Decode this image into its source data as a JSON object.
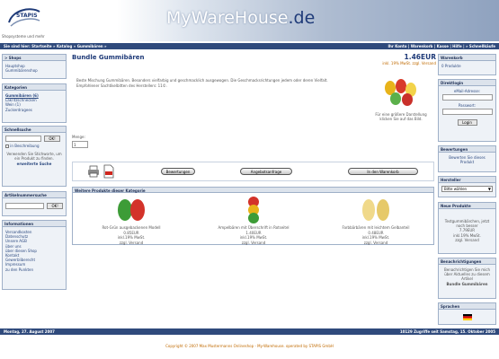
{
  "header": {
    "brand_main": "MyWareHouse",
    "brand_tld": ".de",
    "logo_text": "STAPIS",
    "slogan": "Shopsysteme und mehr"
  },
  "nav": {
    "breadcrumb": "Sie sind hier: Startseite » Katalog » Gummibären »",
    "toplinks": "Ihr Konto | Warenkorb | Kasse | Hilfe | » Schnellkäufe"
  },
  "left": {
    "shops": {
      "title": "> Shops",
      "items": [
        "Hauptshop",
        "Gummibärenshop"
      ]
    },
    "categories": {
      "title": "Kategorien",
      "items": [
        "Gummibären (6)",
        "Lakritzschnecken",
        "Wein (1)",
        "Zuckerdragees"
      ]
    },
    "quicksearch": {
      "title": "Schnellsuche",
      "ok": "OK!",
      "checkbox_label": "in Beschreibung",
      "hint": "Verwenden Sie Stichworte, um ein Produkt zu finden.",
      "advanced": "erweiterte Suche"
    },
    "itemnumber": {
      "title": "Artikelnummersuche",
      "ok": "OK!"
    },
    "info": {
      "title": "Informationen",
      "items": [
        "Versandkosten",
        "Datenschutz",
        "Unsere AGB",
        "über uns",
        "über diesen Shop",
        "Kontakt",
        "Gewerbliberecht",
        "Impressum",
        "zu den Punkten"
      ]
    }
  },
  "product": {
    "title": "Bundle Gummibären",
    "price": "1.46EUR",
    "vat": "inkl. 19% MwSt. zzgl. Versand",
    "description": "Beste Mischung Gummibären. Besonders vielfarbig und geschmacklich ausgewogen. Die Geschmacksrichtungen jedem oder deren Vielfalt. Empfohlener Sachtikelbitten des Herstellers: 11©.",
    "image_caption": "Für eine größere Darstellung klicken Sie auf das Bild.",
    "qty_label": "Menge:",
    "qty_value": "1"
  },
  "actions": {
    "reviews": "Bewertungen",
    "inquiry": "Angebotsanfrage",
    "to_cart": "In den Warenkorb"
  },
  "related": {
    "title": "Weitere Produkte dieser Kategorie",
    "items": [
      {
        "name": "Rot-Grün ausgebackenen Modell",
        "price": "0.85EUR",
        "vat": "inkl.19% MwSt.",
        "ship": "zzgl. Versand"
      },
      {
        "name": "Ampelbären mit Überschrift in Rotseitel",
        "price": "1.40EUR",
        "vat": "inkl.19% MwSt.",
        "ship": "zzgl. Versand"
      },
      {
        "name": "Farbbärbären mit leichtem Gelbanteil",
        "price": "0.48EUR",
        "vat": "inkl.19% MwSt.",
        "ship": "zzgl. Versand"
      }
    ]
  },
  "right": {
    "cart": {
      "title": "Warenkorb",
      "text": "0 Produkte"
    },
    "login": {
      "title": "Direktlogin",
      "email_label": "eMail-Adresse:",
      "password_label": "Passwort:",
      "button": "Login"
    },
    "reviews": {
      "title": "Bewertungen",
      "text": "Bewerten Sie dieses Produkt"
    },
    "manufacturer": {
      "title": "Hersteller",
      "select": "Bitte wählen"
    },
    "new": {
      "title": "Neue Produkte",
      "text": "Testgummibärchen, jetzt noch besser",
      "price": "7.79EUR",
      "vat": "inkl.19% MwSt.",
      "ship": "zzgl. Versand"
    },
    "notify": {
      "title": "Benachrichtigungen",
      "text": "Benachrichtigen Sie mich über Aktuelles zu diesem Artikel",
      "product": "Bundle Gummibären"
    },
    "lang": {
      "title": "Sprachen"
    }
  },
  "footer": {
    "date": "Montag, 27. August 2007",
    "counter": "10129 Zugriffe seit Samstag, 15. Oktober 2005",
    "copyright": "Copyright © 2007 Max Mustermanns Onlineshop - My-Warehouse. operated by STAPIS GmbH"
  },
  "colors": {
    "nav": "#2f4a7c",
    "box_border": "#9fb0c8",
    "title": "#1e3a78",
    "accent": "#c06a00"
  }
}
